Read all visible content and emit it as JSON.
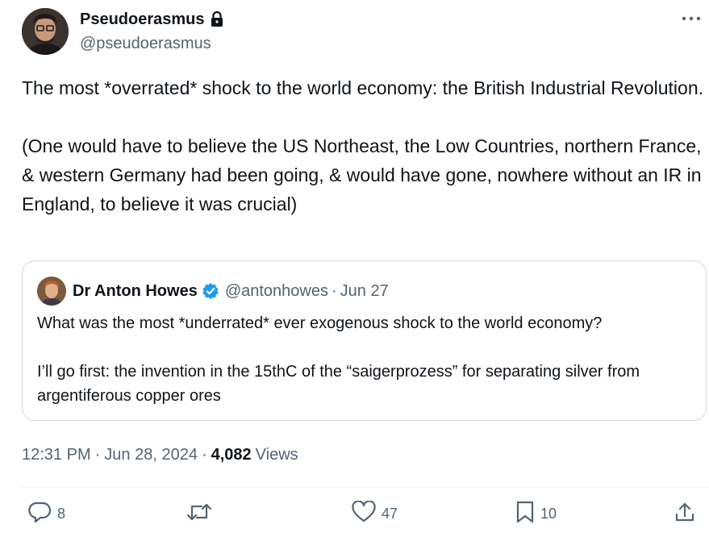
{
  "author": {
    "display_name": "Pseudoerasmus",
    "handle": "@pseudoerasmus"
  },
  "tweet": {
    "text": "The most *overrated* shock to the world economy: the British Industrial Revolution.\n\n(One would have to believe the US Northeast, the Low Countries, northern France, & western Germany had been going, & would have gone, nowhere without an IR in England, to believe it was crucial)"
  },
  "quote": {
    "display_name": "Dr Anton Howes",
    "handle": "@antonhowes",
    "separator": "·",
    "date": "Jun 27",
    "text": "What was the most *underrated* ever exogenous shock to the world economy?\n\nI’ll go first: the invention in the 15thC of the “saigerprozess” for separating silver from argentiferous copper ores"
  },
  "meta": {
    "time": "12:31 PM",
    "separator": "·",
    "date": "Jun 28, 2024",
    "views_count": "4,082",
    "views_label": "Views"
  },
  "actions": {
    "reply_count": "8",
    "retweet_count": "",
    "like_count": "47",
    "bookmark_count": "10"
  },
  "icons": {
    "more": "more-horizontal-icon",
    "lock": "lock-icon",
    "verified": "verified-badge-icon",
    "reply": "reply-icon",
    "retweet": "retweet-icon",
    "like": "heart-icon",
    "bookmark": "bookmark-icon",
    "share": "share-icon"
  },
  "colors": {
    "text": "#0f1419",
    "secondary": "#536471",
    "verified": "#1d9bf0",
    "border": "#cfd9de"
  }
}
